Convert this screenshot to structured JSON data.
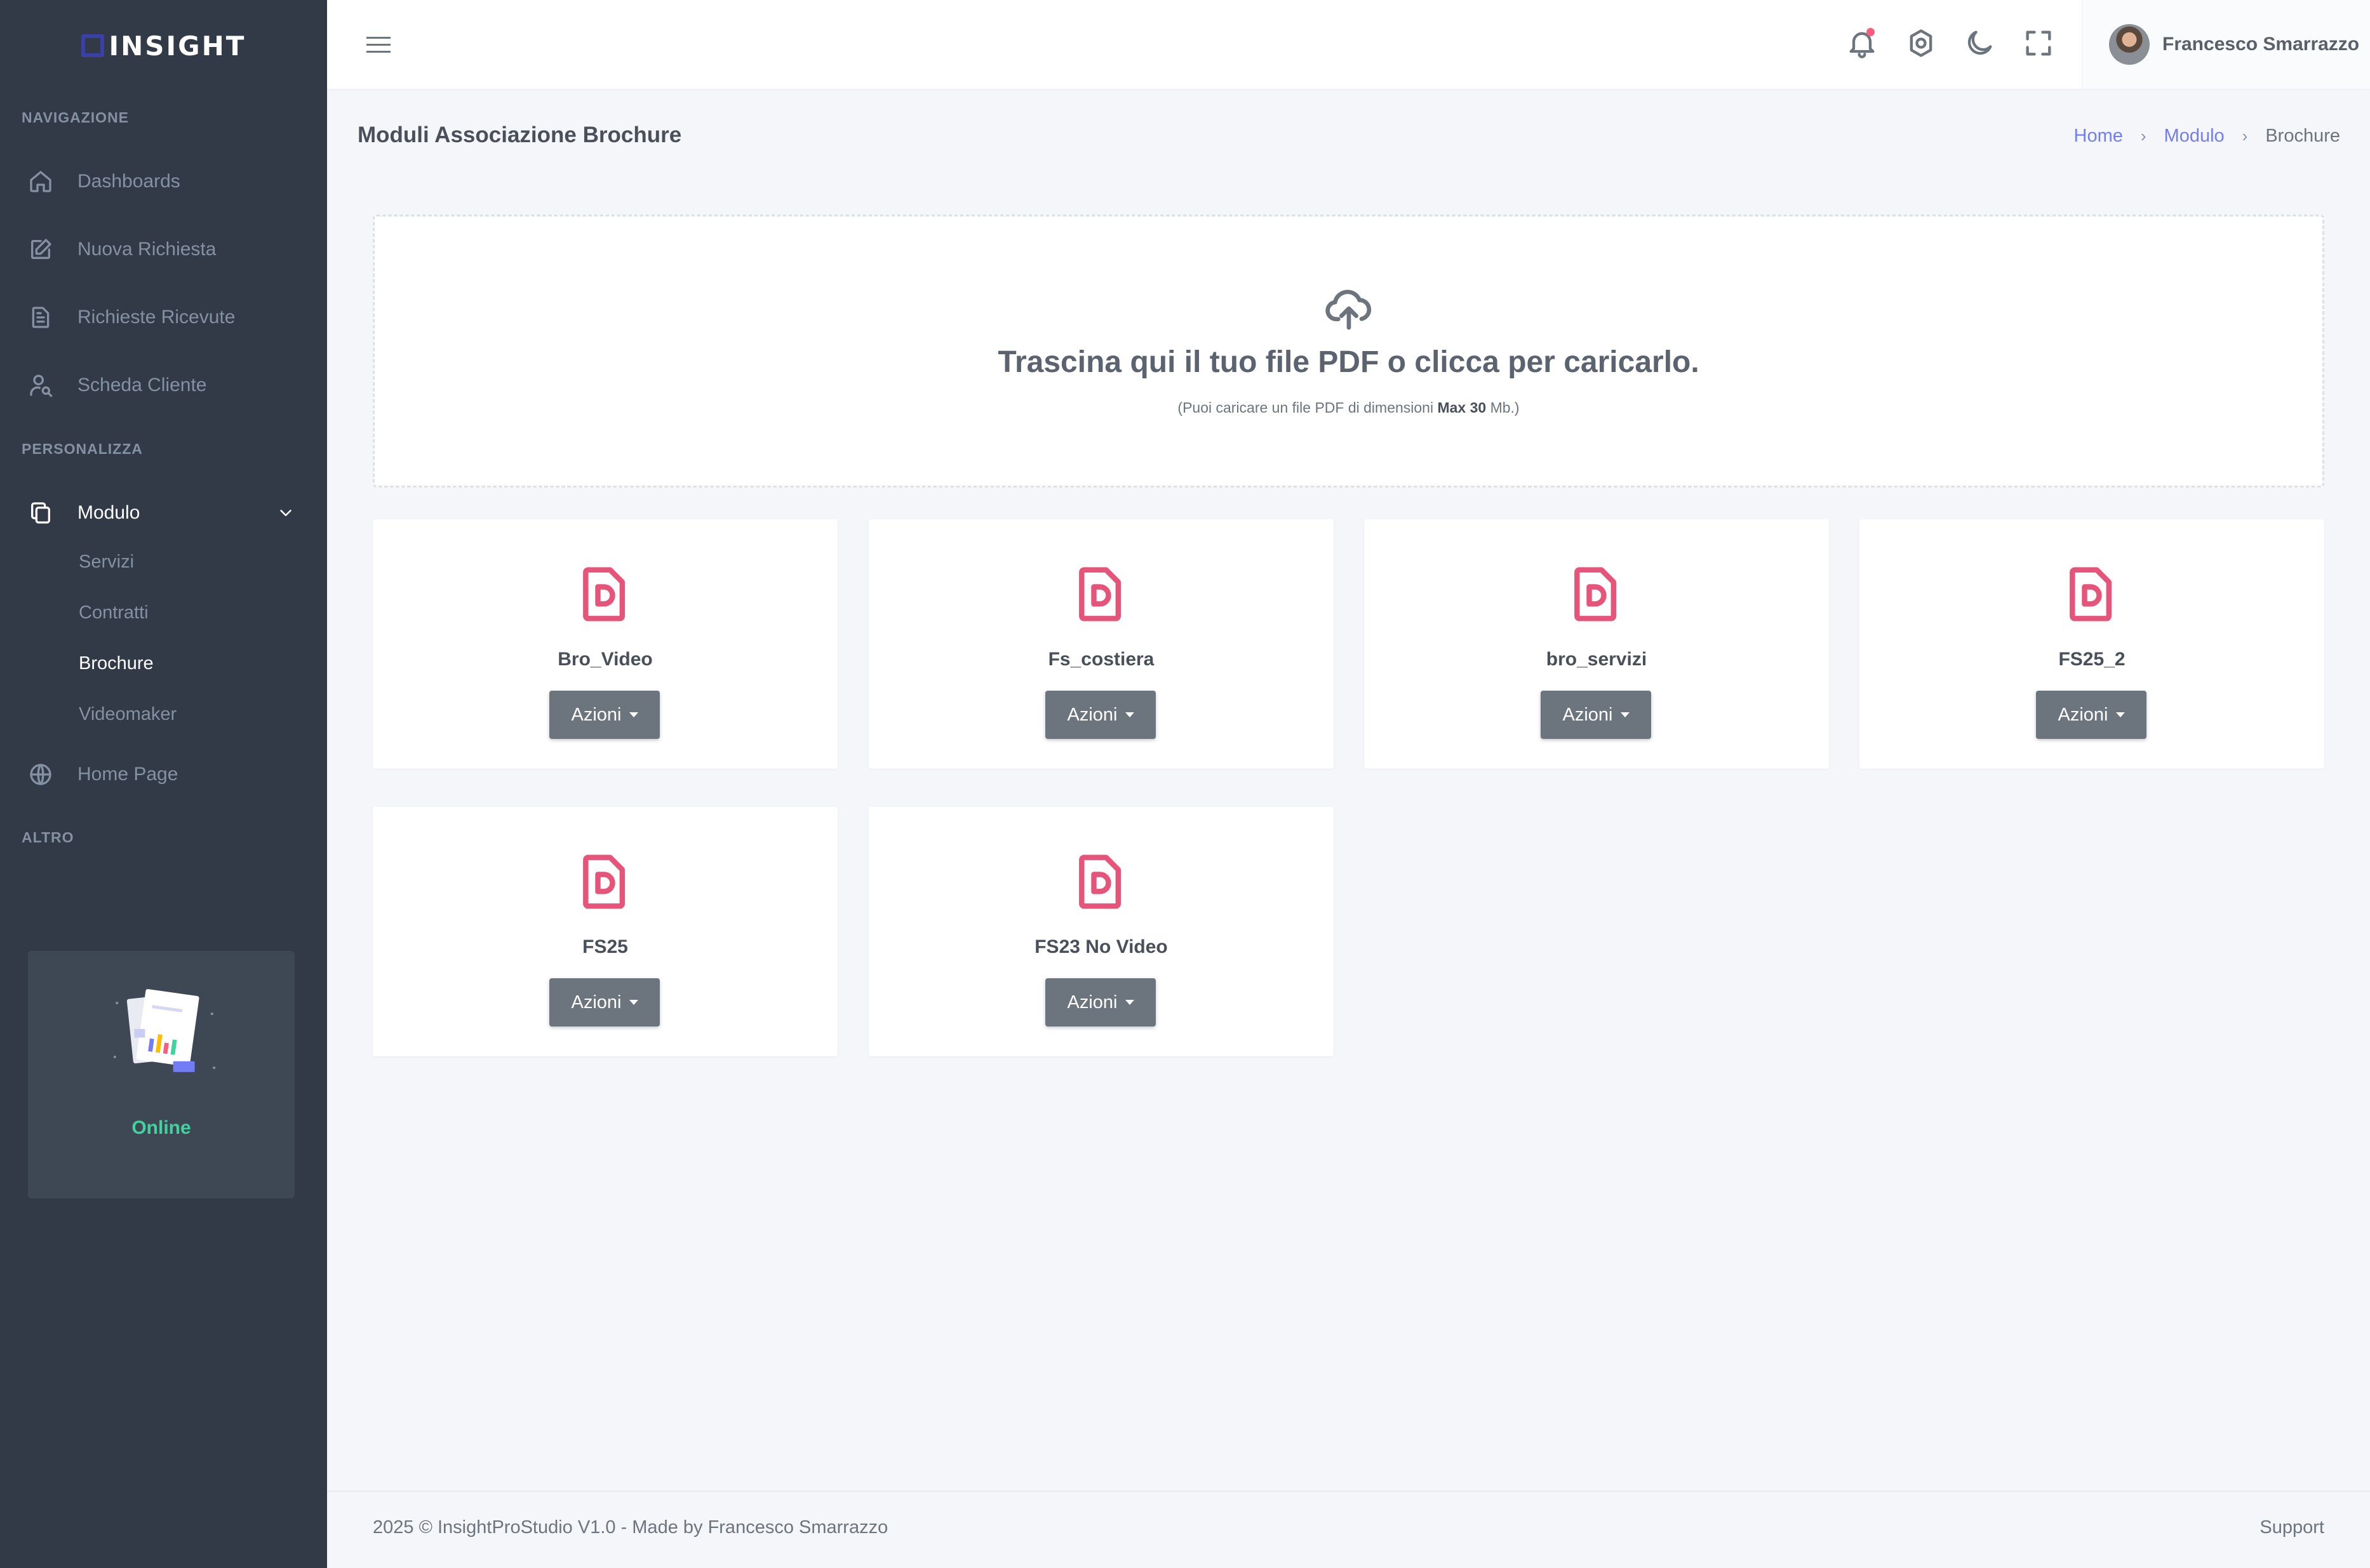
{
  "app": {
    "logo_text": "INSIGHT"
  },
  "sidebar": {
    "sections": {
      "navigazione": "NAVIGAZIONE",
      "personalizza": "PERSONALIZZA",
      "altro": "ALTRO"
    },
    "items": [
      {
        "label": "Dashboards",
        "icon": "home-icon"
      },
      {
        "label": "Nuova Richiesta",
        "icon": "edit-icon"
      },
      {
        "label": "Richieste Ricevute",
        "icon": "document-icon"
      },
      {
        "label": "Scheda Cliente",
        "icon": "user-search-icon"
      },
      {
        "label": "Modulo",
        "icon": "copy-icon",
        "expanded": true
      },
      {
        "label": "Home Page",
        "icon": "globe-icon"
      }
    ],
    "submenu": [
      {
        "label": "Servizi"
      },
      {
        "label": "Contratti"
      },
      {
        "label": "Brochure",
        "active": true
      },
      {
        "label": "Videomaker"
      }
    ],
    "promo": {
      "status": "Online"
    }
  },
  "topbar": {
    "icons": [
      "menu-icon",
      "bell-icon",
      "settings-icon",
      "moon-icon",
      "fullscreen-icon"
    ],
    "user_name": "Francesco Smarrazzo"
  },
  "page": {
    "title": "Moduli Associazione Brochure",
    "breadcrumb": [
      "Home",
      "Modulo",
      "Brochure"
    ]
  },
  "dropzone": {
    "title": "Trascina qui il tuo file PDF o clicca per caricarlo.",
    "sub_prefix": "(Puoi caricare un file PDF di dimensioni",
    "sub_bold": "Max 30",
    "sub_suffix": "Mb.)"
  },
  "files": [
    {
      "name": "Bro_Video",
      "action": "Azioni"
    },
    {
      "name": "Fs_costiera",
      "action": "Azioni"
    },
    {
      "name": "bro_servizi",
      "action": "Azioni"
    },
    {
      "name": "FS25_2",
      "action": "Azioni"
    },
    {
      "name": "FS25",
      "action": "Azioni"
    },
    {
      "name": "FS23 No Video",
      "action": "Azioni"
    }
  ],
  "footer": {
    "copyright": "2025 © InsightProStudio V1.0 - Made by Francesco Smarrazzo",
    "support": "Support"
  },
  "colors": {
    "sidebar_bg": "#313a46",
    "accent": "#727cf5",
    "pdf_icon": "#e6547a",
    "online": "#42d29d",
    "button": "#6c757d"
  }
}
